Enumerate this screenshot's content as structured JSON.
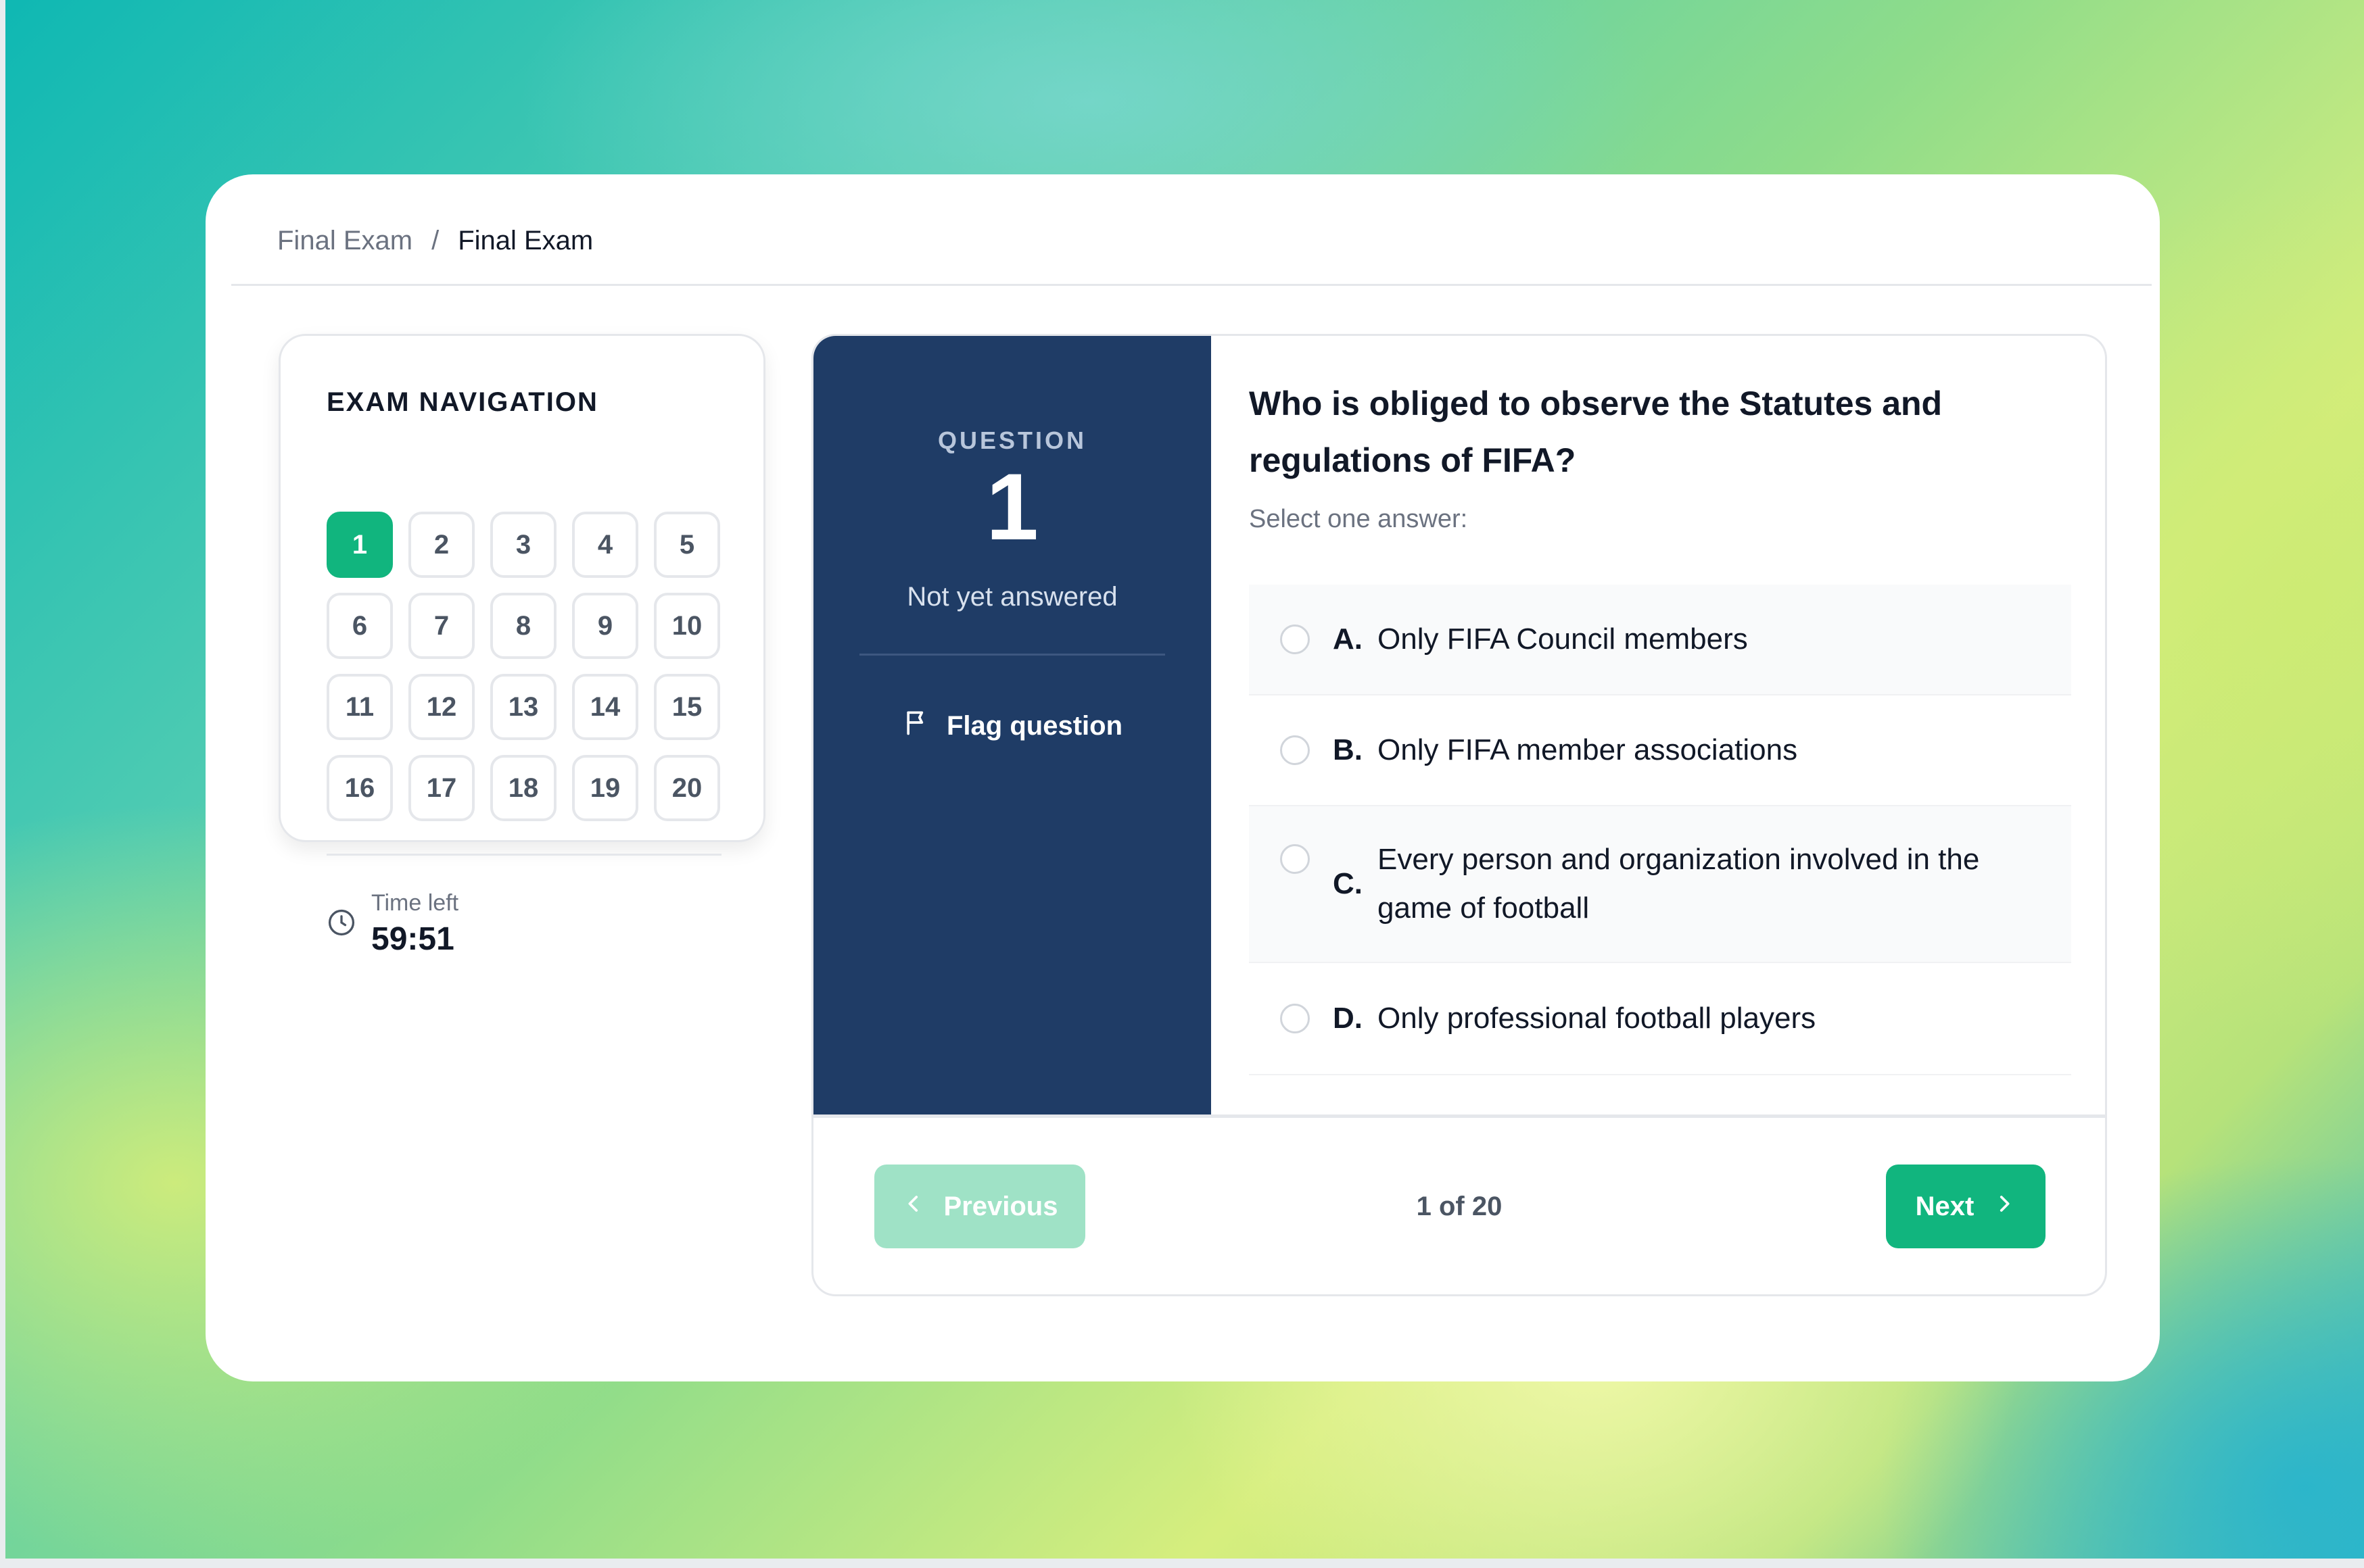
{
  "breadcrumb": {
    "items": [
      "Final Exam",
      "Final Exam"
    ],
    "separator": "/"
  },
  "navigation": {
    "title": "EXAM NAVIGATION",
    "questions": [
      "1",
      "2",
      "3",
      "4",
      "5",
      "6",
      "7",
      "8",
      "9",
      "10",
      "11",
      "12",
      "13",
      "14",
      "15",
      "16",
      "17",
      "18",
      "19",
      "20"
    ],
    "current_question": "1",
    "timer": {
      "label": "Time left",
      "value": "59:51",
      "icon": "clock-icon"
    }
  },
  "question": {
    "label": "QUESTION",
    "number": "1",
    "status": "Not yet answered",
    "flag_label": "Flag question",
    "flag_icon": "flag-icon",
    "text": "Who is obliged to observe the Statutes and regulations of FIFA?",
    "instruction": "Select one answer:",
    "options": [
      {
        "letter": "A.",
        "text": "Only FIFA Council members"
      },
      {
        "letter": "B.",
        "text": "Only FIFA member associations"
      },
      {
        "letter": "C.",
        "text": "Every person and organization involved in the game of football"
      },
      {
        "letter": "D.",
        "text": "Only professional football players"
      }
    ]
  },
  "footer": {
    "previous_label": "Previous",
    "next_label": "Next",
    "page_indicator": "1 of 20"
  },
  "colors": {
    "accent_green": "#11b57e",
    "sidebar_navy": "#1f3c66",
    "previous_disabled": "#9fe2c6"
  }
}
